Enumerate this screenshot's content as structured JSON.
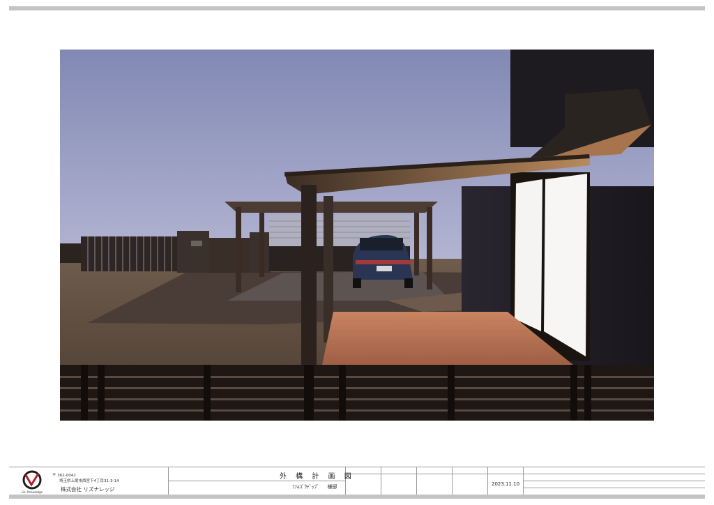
{
  "sheet": {
    "title": "外 構 計 画 図",
    "client_name": "ﾌｧﾑｺﾞｳﾃﾞｯﾌﾟ",
    "client_suffix": "様邸",
    "date": "2023.11.10"
  },
  "company": {
    "logo_text": "Liz. Knowledge",
    "postal": "〒 362-0042",
    "address": "埼玉県上尾市西宮下4丁目31-3-14",
    "name": "株式会社 リズナレッジ",
    "brand_color": "#b0202a"
  },
  "render": {
    "description_icon": "exterior-night-render",
    "sky_color": "#8f96be",
    "wall_color": "#1a1820",
    "deck_color": "#b97352",
    "window_color": "#f6f4f2"
  }
}
